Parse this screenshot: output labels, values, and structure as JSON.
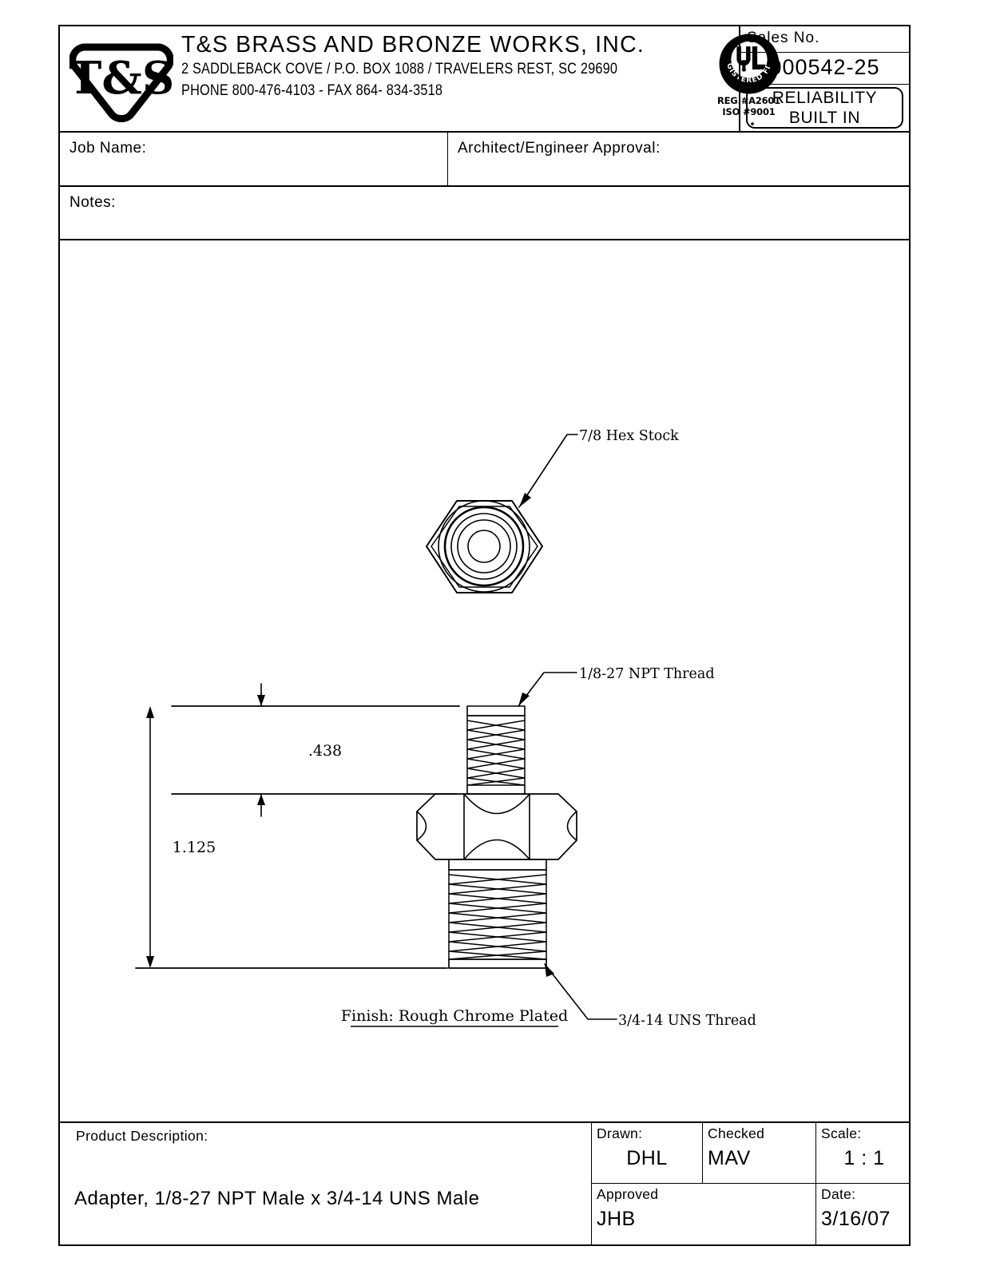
{
  "header": {
    "logo_text": "T&S",
    "company_name": "T&S BRASS AND BRONZE WORKS, INC.",
    "address": "2 SADDLEBACK COVE / P.O. BOX 1088 / TRAVELERS REST, SC 29690",
    "contact": "PHONE 800-476-4103 - FAX  864- 834-3518",
    "ul_mark": "UL",
    "ul_ring_text": "REGISTERED FIRM",
    "ul_reg_line1": "REG.#A2601",
    "ul_reg_line2": "ISO  #9001",
    "sales_no_label": "Sales No.",
    "sales_no_value": "000542-25",
    "badge_line1": "RELIABILITY",
    "badge_line2": "BUILT IN"
  },
  "form": {
    "job_name_label": "Job  Name:",
    "architect_label": "Architect/Engineer  Approval:",
    "notes_label": "Notes:"
  },
  "drawing": {
    "callout_hex": "7/8 Hex Stock",
    "callout_npt": "1/8-27 NPT Thread",
    "callout_uns": "3/4-14 UNS Thread",
    "dim_overall": "1.125",
    "dim_thread": ".438",
    "finish": "Finish: Rough Chrome Plated"
  },
  "title_block": {
    "description_label": "Product  Description:",
    "description_value": "Adapter, 1/8-27 NPT Male x 3/4-14 UNS Male",
    "drawn_label": "Drawn:",
    "drawn_value": "DHL",
    "checked_label": "Checked",
    "checked_value": "MAV",
    "scale_label": "Scale:",
    "scale_value": "1 : 1",
    "approved_label": "Approved",
    "approved_value": "JHB",
    "date_label": "Date:",
    "date_value": "3/16/07"
  },
  "colors": {
    "line": "#000000",
    "paper": "#ffffff"
  }
}
